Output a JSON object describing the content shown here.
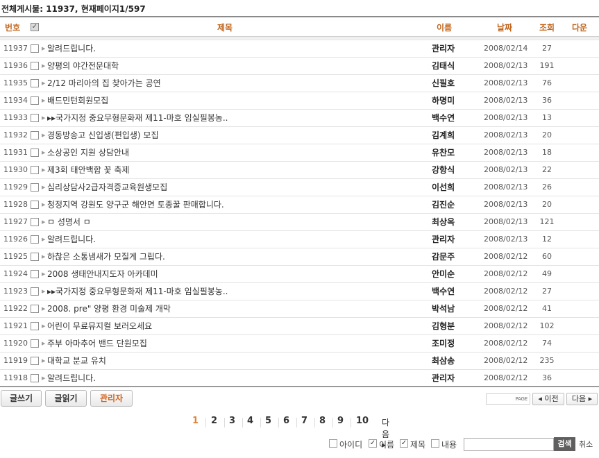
{
  "summary": {
    "label": "전체게시물:",
    "total": "11937,",
    "page_label": "현재페이지",
    "page_value": "1/597"
  },
  "columns": {
    "no": "번호",
    "title": "제목",
    "name": "이름",
    "date": "날짜",
    "views": "조회",
    "download": "다운"
  },
  "header_check": "✓",
  "row_arrow": "▶",
  "rows": [
    {
      "no": "11937",
      "title": "알려드립니다.",
      "name": "관리자",
      "date": "2008/02/14",
      "views": "27"
    },
    {
      "no": "11936",
      "title": "양평의 야간전문대학",
      "name": "김태식",
      "date": "2008/02/13",
      "views": "191"
    },
    {
      "no": "11935",
      "title": "2/12 마리아의 집 찾아가는 공연",
      "name": "신필호",
      "date": "2008/02/13",
      "views": "76"
    },
    {
      "no": "11934",
      "title": "배드민턴회원모집",
      "name": "하명미",
      "date": "2008/02/13",
      "views": "36"
    },
    {
      "no": "11933",
      "title": "▸▸국가지정 중요무형문화재 제11-마호 임실필봉농..",
      "name": "백수연",
      "date": "2008/02/13",
      "views": "13"
    },
    {
      "no": "11932",
      "title": "경동방송고 신입생(편입생) 모집",
      "name": "김계희",
      "date": "2008/02/13",
      "views": "20"
    },
    {
      "no": "11931",
      "title": "소상공인 지원 상담안내",
      "name": "유찬모",
      "date": "2008/02/13",
      "views": "18"
    },
    {
      "no": "11930",
      "title": "제3회 태안백합 꽃 축제",
      "name": "강항식",
      "date": "2008/02/13",
      "views": "22"
    },
    {
      "no": "11929",
      "title": "심리상담사2급자격증교육원생모집",
      "name": "이선희",
      "date": "2008/02/13",
      "views": "26"
    },
    {
      "no": "11928",
      "title": "청정지역 강원도 양구군 해안면 토종꿀 판매합니다.",
      "name": "김진순",
      "date": "2008/02/13",
      "views": "20"
    },
    {
      "no": "11927",
      "title": "ㅁ 성명서 ㅁ",
      "name": "최상옥",
      "date": "2008/02/13",
      "views": "121"
    },
    {
      "no": "11926",
      "title": "알려드립니다.",
      "name": "관리자",
      "date": "2008/02/13",
      "views": "12"
    },
    {
      "no": "11925",
      "title": "하찮은 소통냄새가 모질게 그립다.",
      "name": "감문주",
      "date": "2008/02/12",
      "views": "60"
    },
    {
      "no": "11924",
      "title": "2008 생태안내지도자 아카데미",
      "name": "안미순",
      "date": "2008/02/12",
      "views": "49"
    },
    {
      "no": "11923",
      "title": "▸▸국가지정 중요무형문화재 제11-마호 임실필봉농..",
      "name": "백수연",
      "date": "2008/02/12",
      "views": "27"
    },
    {
      "no": "11922",
      "title": "2008. pre\" 양평 환경 미술제 개막",
      "name": "박석남",
      "date": "2008/02/12",
      "views": "41"
    },
    {
      "no": "11921",
      "title": "어린이 무료뮤지컬 보러오세요",
      "name": "김형분",
      "date": "2008/02/12",
      "views": "102"
    },
    {
      "no": "11920",
      "title": "주부 아마추어 밴드 단원모집",
      "name": "조미정",
      "date": "2008/02/12",
      "views": "74"
    },
    {
      "no": "11919",
      "title": "대학교 분교 유치",
      "name": "최삼송",
      "date": "2008/02/12",
      "views": "235"
    },
    {
      "no": "11918",
      "title": "알려드립니다.",
      "name": "관리자",
      "date": "2008/02/12",
      "views": "36"
    }
  ],
  "buttons": {
    "write": "글쓰기",
    "read": "글읽기",
    "admin": "관리자"
  },
  "page_nav": {
    "page_label": "PAGE",
    "prev": "◂ 이전",
    "next": "다음 ▸"
  },
  "pager": {
    "pages": [
      "1",
      "2",
      "3",
      "4",
      "5",
      "6",
      "7",
      "8",
      "9",
      "10"
    ],
    "current": "1",
    "next": "다음 ▸"
  },
  "search": {
    "options": [
      {
        "label": "아이디",
        "checked": false
      },
      {
        "label": "이름",
        "checked": true
      },
      {
        "label": "제목",
        "checked": true
      },
      {
        "label": "내용",
        "checked": false
      }
    ],
    "check_mark": "✓",
    "button": "검색",
    "cancel": "취소"
  }
}
